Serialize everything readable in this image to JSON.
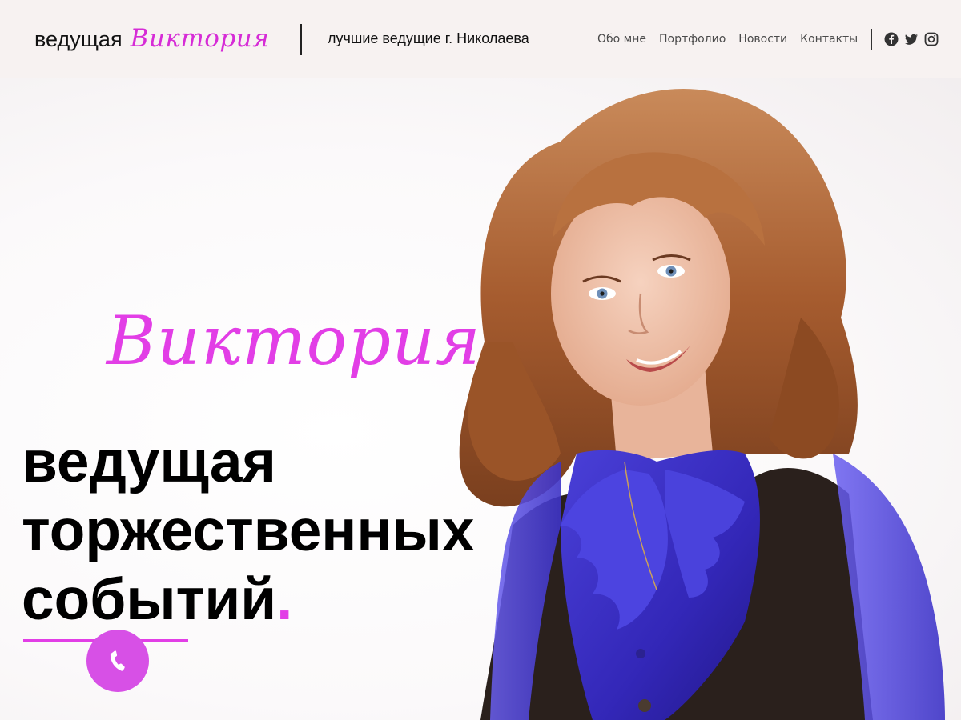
{
  "header": {
    "logo_plain": "ведущая",
    "logo_script": "Виктория",
    "tagline": "лучшие ведущие г. Николаева",
    "nav": [
      "Обо мне",
      "Портфолио",
      "Новости",
      "Контакты"
    ],
    "socials": [
      "facebook-icon",
      "twitter-icon",
      "instagram-icon"
    ]
  },
  "hero": {
    "name_script": "Виктория",
    "headline_lines": [
      "ведущая",
      "торжественных",
      "событий"
    ],
    "headline_dot": ".",
    "phone_icon": "phone-icon"
  },
  "colors": {
    "accent": "#e23ee6",
    "phone_button": "#d750e6",
    "header_bg": "#f7f2f1",
    "blouse": "#3b2fc7",
    "vest": "#2a201c",
    "hair": "#b06a3a"
  }
}
